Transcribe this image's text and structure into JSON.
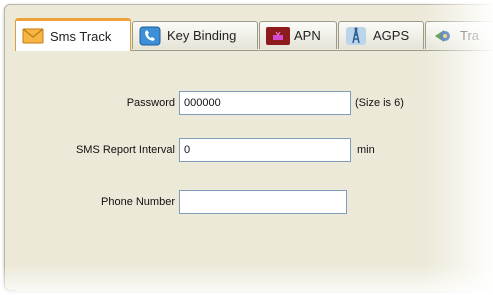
{
  "tabs": [
    {
      "label": "Sms Track",
      "icon": "envelope-icon",
      "active": true
    },
    {
      "label": "Key Binding",
      "icon": "phone-icon",
      "active": false
    },
    {
      "label": "APN",
      "icon": "router-icon",
      "active": false
    },
    {
      "label": "AGPS",
      "icon": "antenna-tower-icon",
      "active": false
    },
    {
      "label": "Tra",
      "icon": "satellite-icon",
      "active": false
    }
  ],
  "form": {
    "password": {
      "label": "Password",
      "value": "000000",
      "hint": "(Size is 6)"
    },
    "interval": {
      "label": "SMS Report Interval",
      "value": "0",
      "unit": "min"
    },
    "phone": {
      "label": "Phone Number",
      "value": ""
    }
  },
  "colors": {
    "panel": "#ece9d8",
    "active_tab_accent": "#f0a23a",
    "input_border": "#7f9db9"
  }
}
